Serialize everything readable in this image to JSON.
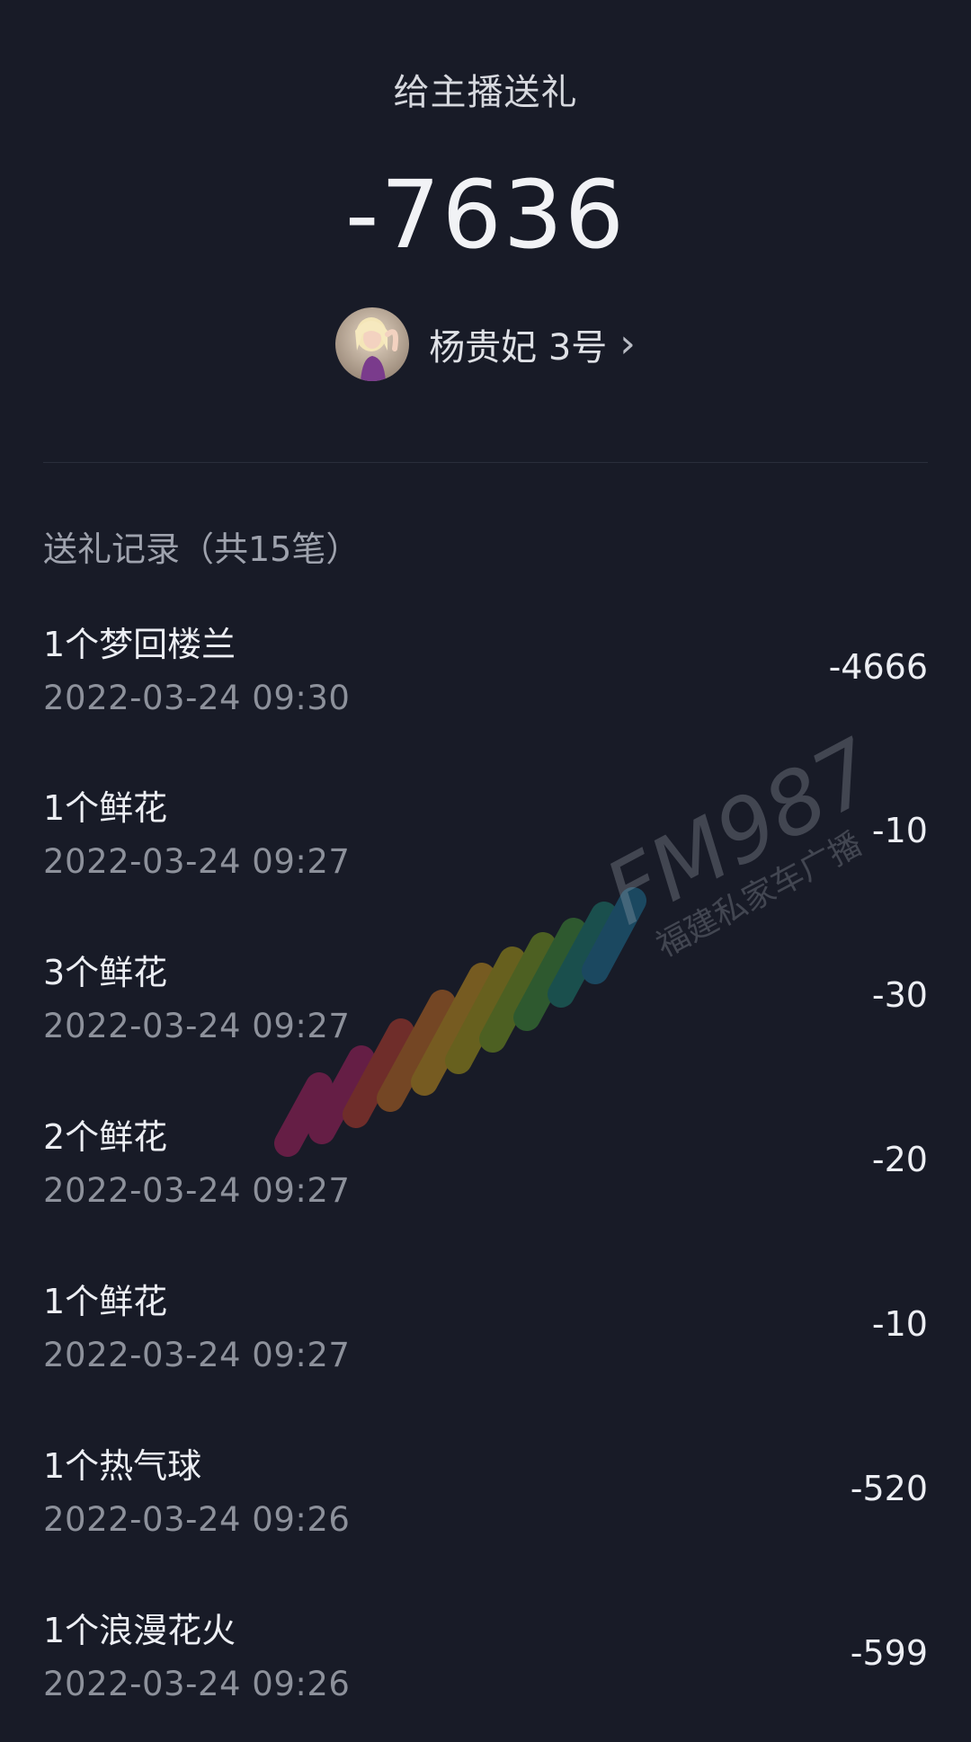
{
  "header": {
    "title": "给主播送礼",
    "total": "-7636"
  },
  "streamer": {
    "name": "杨贵妃 3号"
  },
  "records_header": "送礼记录（共15笔）",
  "records": [
    {
      "name": "1个梦回楼兰",
      "time": "2022-03-24 09:30",
      "amount": "-4666"
    },
    {
      "name": "1个鲜花",
      "time": "2022-03-24 09:27",
      "amount": "-10"
    },
    {
      "name": "3个鲜花",
      "time": "2022-03-24 09:27",
      "amount": "-30"
    },
    {
      "name": "2个鲜花",
      "time": "2022-03-24 09:27",
      "amount": "-20"
    },
    {
      "name": "1个鲜花",
      "time": "2022-03-24 09:27",
      "amount": "-10"
    },
    {
      "name": "1个热气球",
      "time": "2022-03-24 09:26",
      "amount": "-520"
    },
    {
      "name": "1个浪漫花火",
      "time": "2022-03-24 09:26",
      "amount": "-599"
    }
  ],
  "watermark": {
    "brand": "FM987",
    "subtitle": "福建私家车广播"
  },
  "colors": {
    "background": "#181b27",
    "text": "#eceef3",
    "muted": "#8d919b"
  }
}
